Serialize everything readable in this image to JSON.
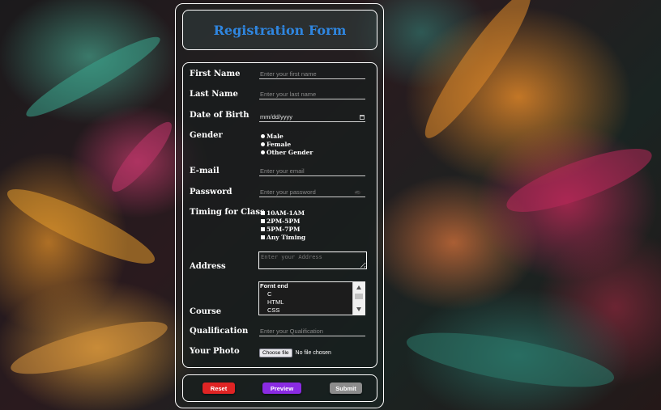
{
  "title": "Registration Form",
  "fields": {
    "first_name": {
      "label": "First Name",
      "placeholder": "Enter your first name"
    },
    "last_name": {
      "label": "Last Name",
      "placeholder": "Enter your last name"
    },
    "dob": {
      "label": "Date of Birth",
      "value": "mm/dd/yyyy"
    },
    "gender": {
      "label": "Gender",
      "options": [
        "Male",
        "Female",
        "Other Gender"
      ]
    },
    "email": {
      "label": "E-mail",
      "placeholder": "Enter your email"
    },
    "password": {
      "label": "Password",
      "placeholder": "Enter your password"
    },
    "timing": {
      "label": "Timing for Class",
      "options": [
        "10AM-1AM",
        "2PM-5PM",
        "5PM-7PM",
        "Any Timing"
      ]
    },
    "address": {
      "label": "Address",
      "placeholder": "Enter your Address"
    },
    "course": {
      "label": "Course",
      "group": "Fornt end",
      "options": [
        "C",
        "HTML",
        "CSS"
      ]
    },
    "qualification": {
      "label": "Qualification",
      "placeholder": "Enter your Qualification"
    },
    "photo": {
      "label": "Your Photo",
      "button": "Choose file",
      "status": "No file chosen"
    }
  },
  "buttons": {
    "reset": {
      "label": "Reset",
      "color": "#e02424"
    },
    "preview": {
      "label": "Preview",
      "color": "#8a2be2"
    },
    "submit": {
      "label": "Submit",
      "color": "#8c8c8c"
    }
  },
  "colors": {
    "title": "#2f86e0"
  }
}
